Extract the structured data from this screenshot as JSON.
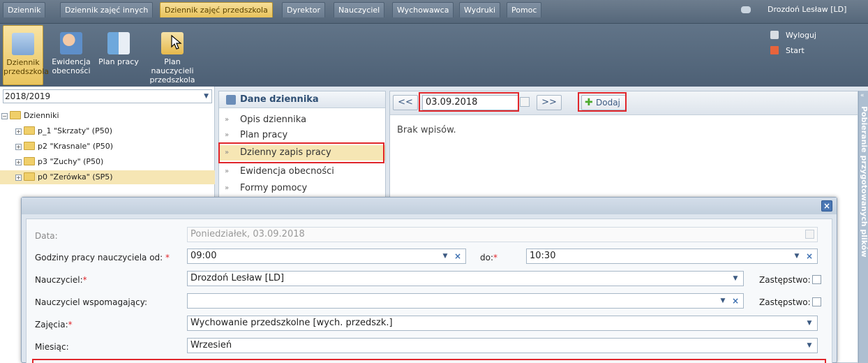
{
  "menu": {
    "tabs": [
      "Dziennik",
      "Dziennik zajęć innych",
      "Dziennik zajęć przedszkola",
      "Dyrektor",
      "Nauczyciel",
      "Wychowawca",
      "Wydruki",
      "Pomoc"
    ],
    "active_tab": "Dziennik zajęć przedszkola",
    "user_name": "Drozdoń Lesław [LD]"
  },
  "ribbon": {
    "buttons": [
      {
        "label": "Dziennik\nprzedszkola"
      },
      {
        "label": "Ewidencja\nobecności"
      },
      {
        "label": "Plan pracy"
      },
      {
        "label": "Plan nauczycieli\nprzedszkola"
      }
    ],
    "logout_label": "Wyloguj",
    "start_label": "Start"
  },
  "tree": {
    "year": "2018/2019",
    "root_label": "Dzienniki",
    "items": [
      "p_1 \"Skrzaty\" (P50)",
      "p2 \"Krasnale\" (P50)",
      "p3 \"Zuchy\" (P50)",
      "p0 \"Zerówka\" (SP5)"
    ],
    "selected_index": 3
  },
  "nav": {
    "header": "Dane dziennika",
    "items": [
      "Opis dziennika",
      "Plan pracy",
      "Dzienny zapis pracy",
      "Ewidencja obecności",
      "Formy pomocy"
    ],
    "active_item": "Dzienny zapis pracy"
  },
  "toolbar": {
    "prev_label": "<<",
    "next_label": ">>",
    "date": "03.09.2018",
    "add_label": "Dodaj"
  },
  "content": {
    "empty_text": "Brak wpisów."
  },
  "side_panel": {
    "title": "Pobieranie przygotowanych plików"
  },
  "dialog": {
    "close_label": "×",
    "date_label": "Data:",
    "date_value": "Poniedziałek, 03.09.2018",
    "hours_label": "Godziny pracy nauczyciela od:",
    "hours_from": "09:00",
    "hours_to_label": "do:",
    "hours_to": "10:30",
    "teacher_label": "Nauczyciel:",
    "teacher_value": "Drozdoń Lesław [LD]",
    "substitution_label": "Zastępstwo:",
    "assistant_label": "Nauczyciel wspomagający:",
    "assistant_value": "",
    "classes_label": "Zajęcia:",
    "classes_value": "Wychowanie przedszkolne [wych. przedszk.]",
    "month_label": "Miesiąc:",
    "month_value": "Wrzesień",
    "required_mark": "*"
  },
  "colors": {
    "accent": "#e8c25a",
    "highlight": "#e0262b",
    "header": "#55677a"
  }
}
